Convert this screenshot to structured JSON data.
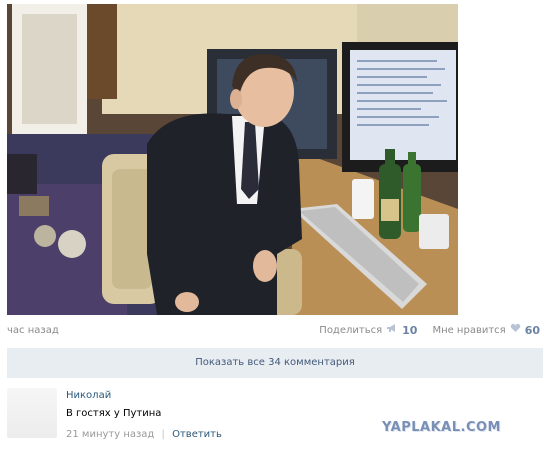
{
  "post": {
    "time": "час назад",
    "share_label": "Поделиться",
    "share_count": "10",
    "like_label": "Мне нравится",
    "like_count": "60",
    "share_icon": "megaphone-icon",
    "like_icon": "heart-icon"
  },
  "comments_bar": {
    "label": "Показать все 34 комментария"
  },
  "comment": {
    "author": "Николай",
    "text": "В гостях у Путина",
    "time": "21 минуту назад",
    "separator": "|",
    "reply_label": "Ответить"
  },
  "watermark": "YAPLAKAL.COM",
  "colors": {
    "link": "#2b587a",
    "count": "#6b83a3",
    "bar_bg": "#e8edf2",
    "muted": "#8a8a8a"
  }
}
